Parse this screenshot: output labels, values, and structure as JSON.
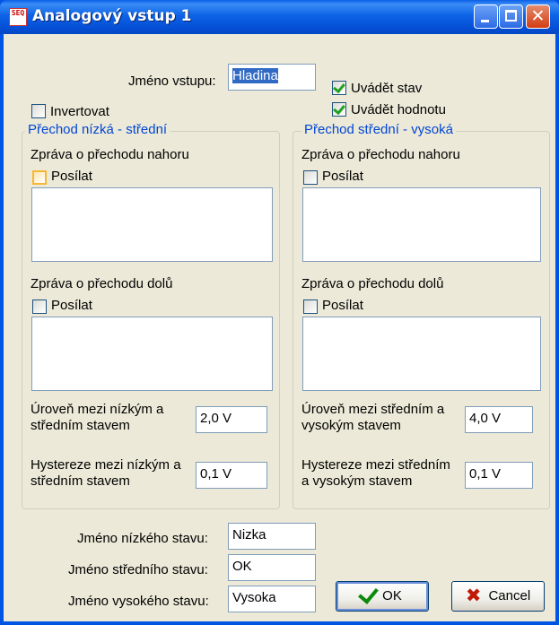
{
  "window": {
    "title": "Analogový vstup 1",
    "app_icon": "SEQ"
  },
  "top": {
    "input_name_label": "Jméno vstupu:",
    "input_name_value": "Hladina",
    "invert_label": "Invertovat",
    "invert_checked": false,
    "show_state_label": "Uvádět stav",
    "show_state_checked": true,
    "show_value_label": "Uvádět hodnotu",
    "show_value_checked": true
  },
  "group_low_mid": {
    "title": "Přechod nízká - střední",
    "up_label": "Zpráva o přechodu nahoru",
    "up_send": "Posílat",
    "down_label": "Zpráva o přechodu dolů",
    "down_send": "Posílat",
    "level_label_1": "Úroveň mezi nízkým a",
    "level_label_2": "středním stavem",
    "level_value": "2,0 V",
    "hyst_label_1": "Hystereze mezi nízkým a",
    "hyst_label_2": "středním stavem",
    "hyst_value": "0,1 V"
  },
  "group_mid_high": {
    "title": "Přechod střední - vysoká",
    "up_label": "Zpráva o přechodu nahoru",
    "up_send": "Posílat",
    "down_label": "Zpráva o přechodu dolů",
    "down_send": "Posílat",
    "level_label_1": "Úroveň mezi středním a",
    "level_label_2": "vysokým stavem",
    "level_value": "4,0 V",
    "hyst_label_1": "Hystereze mezi středním",
    "hyst_label_2": "a vysokým stavem",
    "hyst_value": "0,1 V"
  },
  "states": {
    "low_label": "Jméno nízkého stavu:",
    "low_value": "Nizka",
    "mid_label": "Jméno středního stavu:",
    "mid_value": "OK",
    "high_label": "Jméno vysokého stavu:",
    "high_value": "Vysoka"
  },
  "buttons": {
    "ok": "OK",
    "cancel": "Cancel"
  }
}
